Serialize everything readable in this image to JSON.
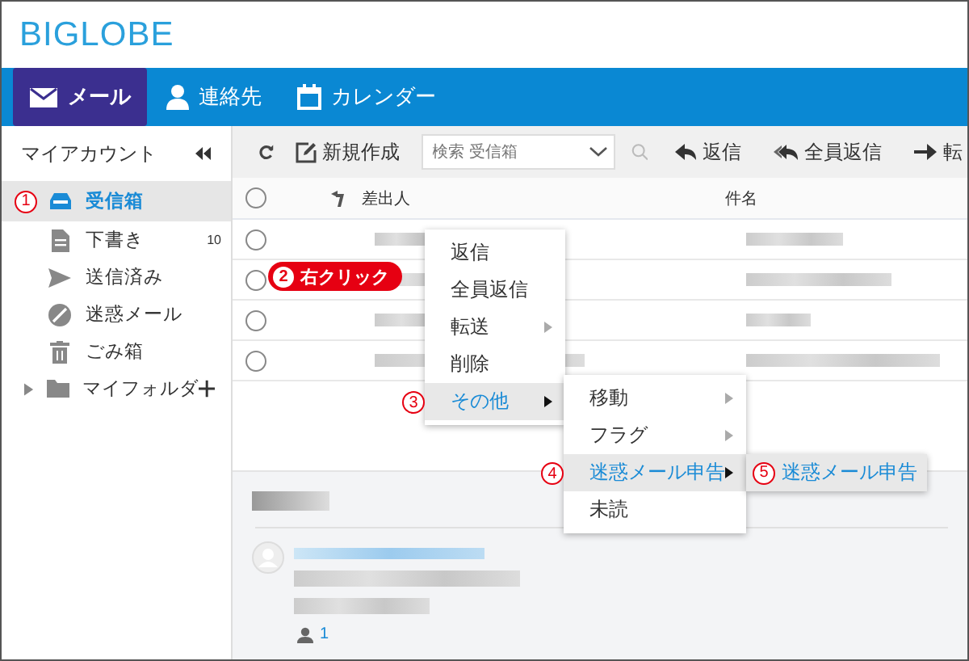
{
  "logo": {
    "text": "BIGLOBE"
  },
  "nav": [
    {
      "label": "メール",
      "selected": true
    },
    {
      "label": "連絡先",
      "selected": false
    },
    {
      "label": "カレンダー",
      "selected": false
    }
  ],
  "sidebar": {
    "title": "マイアカウント",
    "items": [
      {
        "label": "受信箱",
        "selected": true,
        "annotation": "1"
      },
      {
        "label": "下書き",
        "selected": false,
        "count": "10"
      },
      {
        "label": "送信済み",
        "selected": false
      },
      {
        "label": "迷惑メール",
        "selected": false
      },
      {
        "label": "ごみ箱",
        "selected": false
      },
      {
        "label": "マイフォルダ",
        "selected": false,
        "expanded": false
      }
    ]
  },
  "toolbar": {
    "compose": "新規作成",
    "search": {
      "placeholder": "検索 受信箱"
    },
    "actions": [
      "返信",
      "全員返信",
      "転"
    ]
  },
  "table": {
    "select_all": {
      "checked": false
    },
    "columns": [
      "差出人",
      "件名"
    ],
    "rows": [
      {
        "checked": false
      },
      {
        "checked": false
      },
      {
        "checked": false
      },
      {
        "checked": false
      }
    ]
  },
  "callout": {
    "annotation": "2",
    "text": "右クリック"
  },
  "context_menu": {
    "items": [
      {
        "label": "返信",
        "submenu": false,
        "highlighted": false
      },
      {
        "label": "全員返信",
        "submenu": false,
        "highlighted": false
      },
      {
        "label": "転送",
        "submenu": true,
        "highlighted": false
      },
      {
        "label": "削除",
        "submenu": false,
        "highlighted": false
      },
      {
        "label": "その他",
        "submenu": true,
        "highlighted": true,
        "annotation": "3"
      }
    ]
  },
  "submenu": {
    "items": [
      {
        "label": "移動",
        "submenu": true,
        "highlighted": false
      },
      {
        "label": "フラグ",
        "submenu": true,
        "highlighted": false
      },
      {
        "label": "迷惑メール申告",
        "submenu": true,
        "highlighted": true,
        "annotation": "4"
      },
      {
        "label": "未読",
        "submenu": false,
        "highlighted": false
      }
    ]
  },
  "submenu_2": {
    "items": [
      {
        "label": "迷惑メール申告",
        "highlighted": true,
        "annotation": "5"
      }
    ]
  },
  "preview": {
    "recipient_count": "1"
  }
}
